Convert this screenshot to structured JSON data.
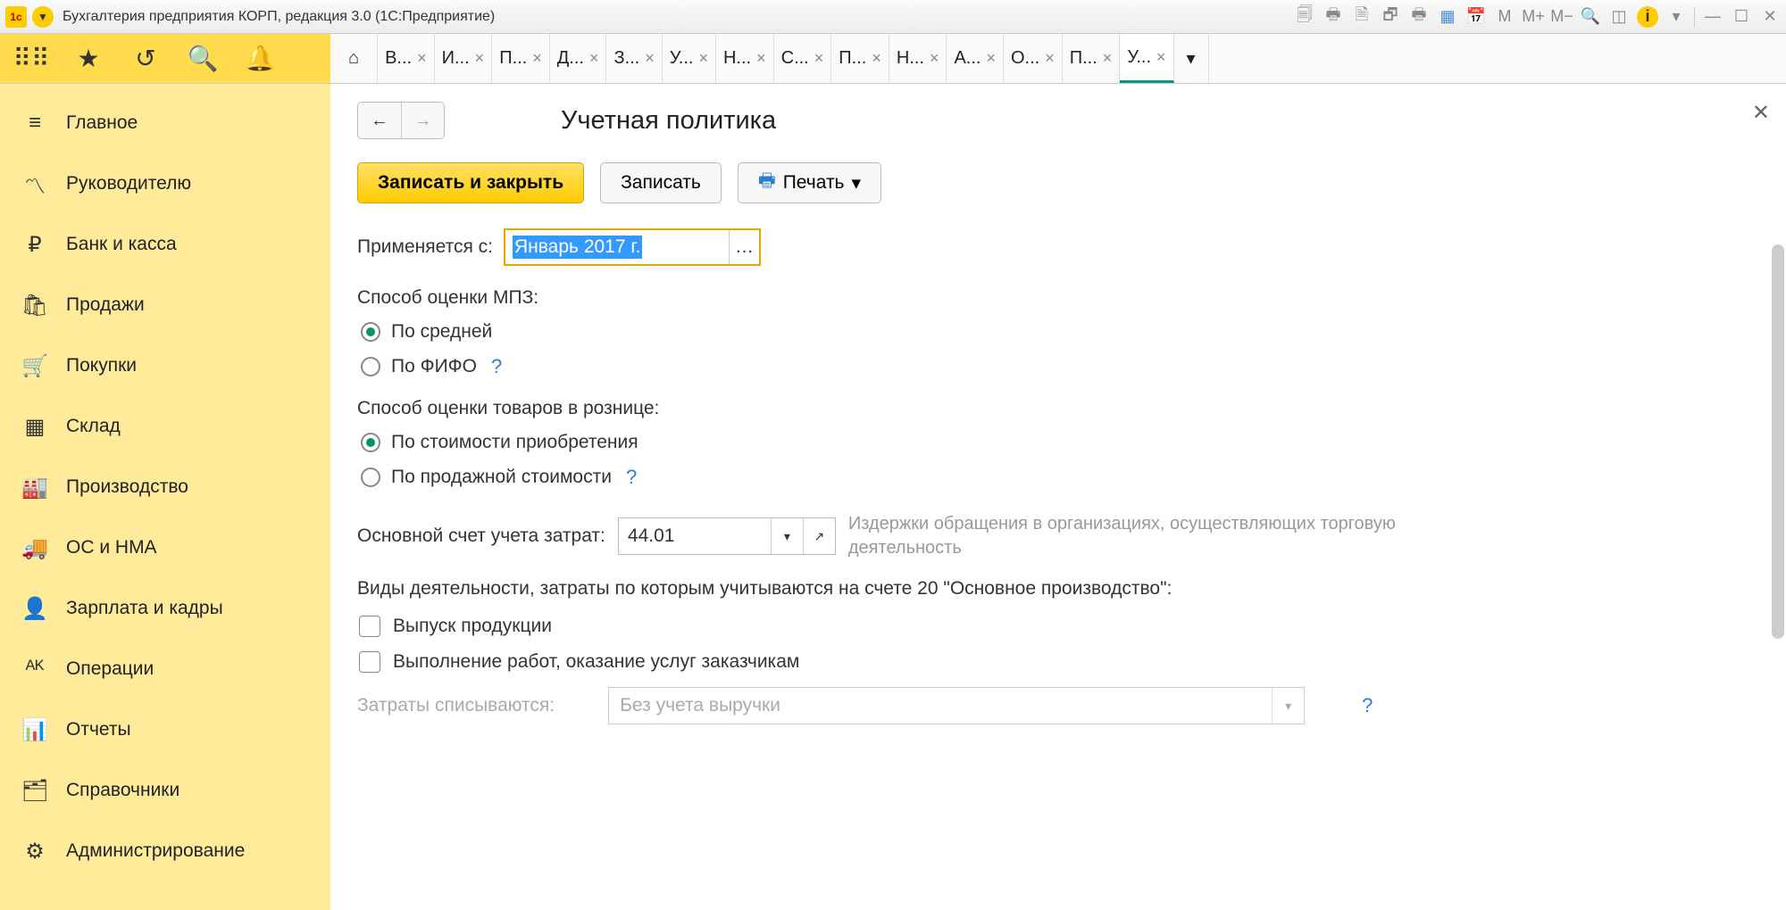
{
  "window": {
    "title": "Бухгалтерия предприятия КОРП, редакция 3.0  (1С:Предприятие)"
  },
  "win_icons": {
    "m": "M",
    "mplus": "M+",
    "mminus": "M−"
  },
  "tabs": [
    {
      "label": "В..."
    },
    {
      "label": "И..."
    },
    {
      "label": "П..."
    },
    {
      "label": "Д..."
    },
    {
      "label": "З..."
    },
    {
      "label": "У..."
    },
    {
      "label": "Н..."
    },
    {
      "label": "С..."
    },
    {
      "label": "П..."
    },
    {
      "label": "Н..."
    },
    {
      "label": "А..."
    },
    {
      "label": "О..."
    },
    {
      "label": "П..."
    },
    {
      "label": "У...",
      "active": true
    }
  ],
  "sidebar": [
    {
      "icon": "≡",
      "label": "Главное"
    },
    {
      "icon": "〽",
      "label": "Руководителю"
    },
    {
      "icon": "₽",
      "label": "Банк и касса"
    },
    {
      "icon": "🛍",
      "label": "Продажи"
    },
    {
      "icon": "🛒",
      "label": "Покупки"
    },
    {
      "icon": "▦",
      "label": "Склад"
    },
    {
      "icon": "🏭",
      "label": "Производство"
    },
    {
      "icon": "🚚",
      "label": "ОС и НМА"
    },
    {
      "icon": "👤",
      "label": "Зарплата и кадры"
    },
    {
      "icon": "ᴬᴷ",
      "label": "Операции"
    },
    {
      "icon": "📊",
      "label": "Отчеты"
    },
    {
      "icon": "🗂",
      "label": "Справочники"
    },
    {
      "icon": "⚙",
      "label": "Администрирование"
    }
  ],
  "page": {
    "title": "Учетная политика",
    "save_close": "Записать и закрыть",
    "save": "Записать",
    "print": "Печать",
    "applies_from_lbl": "Применяется с:",
    "applies_from_val": "Январь 2017 г.",
    "mpz_label": "Способ оценки МПЗ:",
    "mpz_avg": "По средней",
    "mpz_fifo": "По ФИФО",
    "retail_label": "Способ оценки товаров в рознице:",
    "retail_cost": "По стоимости приобретения",
    "retail_sale": "По продажной стоимости",
    "account_lbl": "Основной счет учета затрат:",
    "account_val": "44.01",
    "account_hint": "Издержки обращения в организациях, осуществляющих торговую деятельность",
    "activities_lbl": "Виды деятельности, затраты по которым учитываются на счете 20 \"Основное производство\":",
    "chk_output": "Выпуск продукции",
    "chk_services": "Выполнение работ, оказание услуг заказчикам",
    "costs_writeoff_lbl": "Затраты списываются:",
    "costs_writeoff_val": "Без учета выручки"
  }
}
